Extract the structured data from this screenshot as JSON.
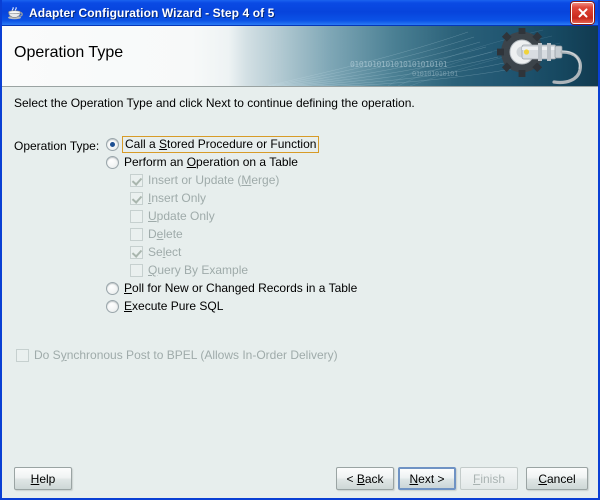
{
  "window": {
    "title": "Adapter Configuration Wizard - Step 4 of 5",
    "icon": "java-coffee-cup-icon",
    "close_label": "Close"
  },
  "banner": {
    "title": "Operation Type",
    "binary_line_1": "0101010101010101010101",
    "binary_line_2": "010101010101",
    "icon": "gear-cable-icon"
  },
  "content": {
    "instruction": "Select the Operation Type and click Next to continue defining the operation.",
    "operation_type_label": "Operation Type:",
    "radios": [
      {
        "id": "call-stored-procedure",
        "label_pre": "Call a ",
        "label_mnemonic": "S",
        "label_post": "tored Procedure or Function",
        "checked": true,
        "focused": true,
        "enabled": true
      },
      {
        "id": "perform-operation-on-table",
        "label_pre": "Perform an ",
        "label_mnemonic": "O",
        "label_post": "peration on a Table",
        "checked": false,
        "focused": false,
        "enabled": true
      },
      {
        "id": "poll-for-records",
        "label_pre": "",
        "label_mnemonic": "P",
        "label_post": "oll for New or Changed Records in a Table",
        "checked": false,
        "focused": false,
        "enabled": true
      },
      {
        "id": "execute-pure-sql",
        "label_pre": "",
        "label_mnemonic": "E",
        "label_post": "xecute Pure SQL",
        "checked": false,
        "focused": false,
        "enabled": true
      }
    ],
    "table_operations": [
      {
        "id": "insert-or-update-merge",
        "label_pre": "Insert or Update (",
        "label_mnemonic": "M",
        "label_post": "erge)",
        "checked": true,
        "enabled": false
      },
      {
        "id": "insert-only",
        "label_pre": "",
        "label_mnemonic": "I",
        "label_post": "nsert Only",
        "checked": true,
        "enabled": false
      },
      {
        "id": "update-only",
        "label_pre": "",
        "label_mnemonic": "U",
        "label_post": "pdate Only",
        "checked": false,
        "enabled": false
      },
      {
        "id": "delete",
        "label_pre": "D",
        "label_mnemonic": "e",
        "label_post": "lete",
        "checked": false,
        "enabled": false
      },
      {
        "id": "select",
        "label_pre": "Se",
        "label_mnemonic": "l",
        "label_post": "ect",
        "checked": true,
        "enabled": false
      },
      {
        "id": "query-by-example",
        "label_pre": "",
        "label_mnemonic": "Q",
        "label_post": "uery By Example",
        "checked": false,
        "enabled": false
      }
    ],
    "sync_post": {
      "id": "do-synchronous-post-to-bpel",
      "label_pre": "Do S",
      "label_mnemonic": "y",
      "label_post": "nchronous Post to BPEL (Allows In-Order Delivery)",
      "checked": false,
      "enabled": false
    }
  },
  "buttons": {
    "help": {
      "label": "Help",
      "mnemonic": "H",
      "enabled": true,
      "default": false
    },
    "back": {
      "label": "< Back",
      "mnemonic": "B",
      "enabled": true,
      "default": false
    },
    "next": {
      "label": "Next >",
      "mnemonic": "N",
      "enabled": true,
      "default": true
    },
    "finish": {
      "label": "Finish",
      "mnemonic": "F",
      "enabled": false,
      "default": false
    },
    "cancel": {
      "label": "Cancel",
      "mnemonic": "C",
      "enabled": true,
      "default": false
    }
  },
  "colors": {
    "titlebar_blue": "#0a4ae4",
    "window_border": "#0a3fd4",
    "content_background": "#e7eeed",
    "focus_ring": "#d79b28",
    "radio_dot": "#1d4f92",
    "close_red": "#c9281b",
    "disabled_text": "#9fabaa"
  }
}
